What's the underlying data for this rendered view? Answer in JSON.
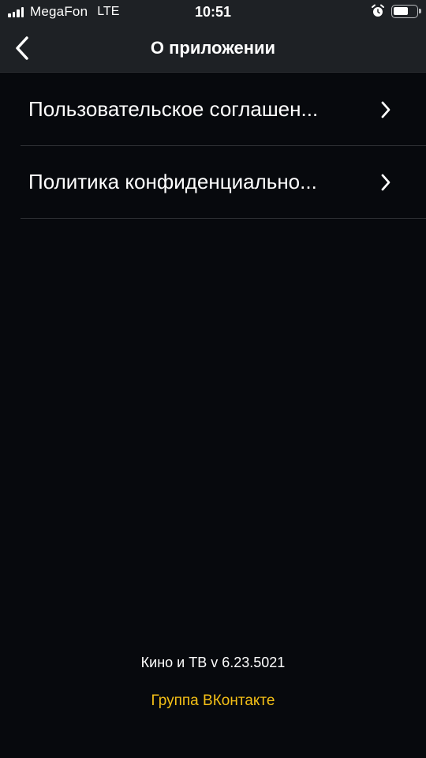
{
  "status_bar": {
    "carrier": "MegaFon",
    "network": "LTE",
    "time": "10:51"
  },
  "nav": {
    "title": "О приложении",
    "back_icon": "chevron-left-icon"
  },
  "menu": {
    "items": [
      {
        "label": "Пользовательское соглашен...",
        "icon": "chevron-right-icon"
      },
      {
        "label": "Политика конфиденциально...",
        "icon": "chevron-right-icon"
      }
    ]
  },
  "footer": {
    "version": "Кино и ТВ v 6.23.5021",
    "vk_link": "Группа ВКонтакте",
    "link_color": "#f4c016"
  },
  "colors": {
    "background": "#07090d",
    "bar": "#1e2125",
    "accent": "#f4c016"
  }
}
